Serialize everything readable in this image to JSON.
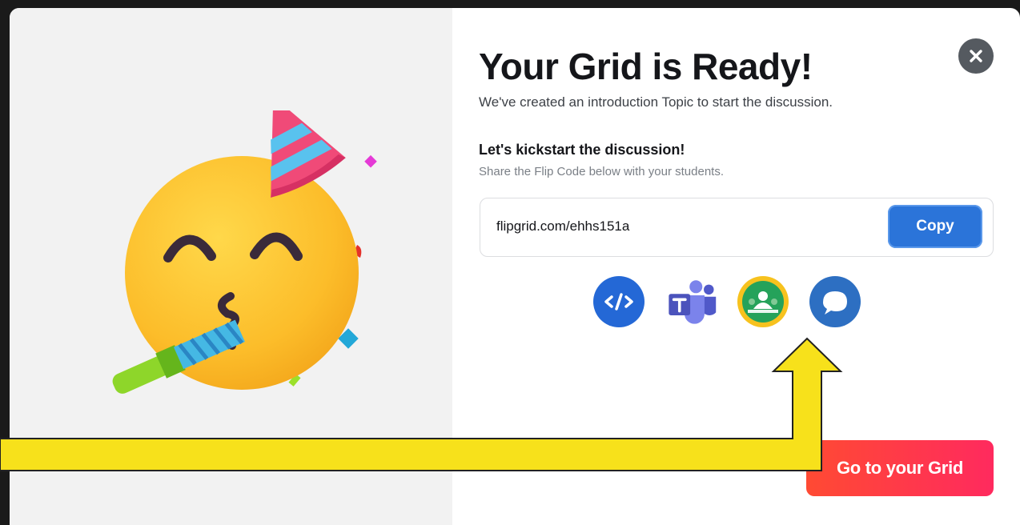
{
  "modal": {
    "title": "Your Grid is Ready!",
    "subtitle": "We've created an introduction Topic to start the discussion.",
    "kickstart_title": "Let's kickstart the discussion!",
    "kickstart_subtitle": "Share the Flip Code below with your students.",
    "flip_code_url": "flipgrid.com/ehhs151a",
    "copy_label": "Copy",
    "go_label": "Go to your Grid",
    "share_icons": [
      "embed-code-icon",
      "microsoft-teams-icon",
      "google-classroom-icon",
      "remind-icon"
    ]
  },
  "colors": {
    "copy_button": "#2b74d9",
    "go_button": "#ff3a4a",
    "annotation_arrow": "#f7e11b",
    "left_panel": "#f2f2f2"
  }
}
